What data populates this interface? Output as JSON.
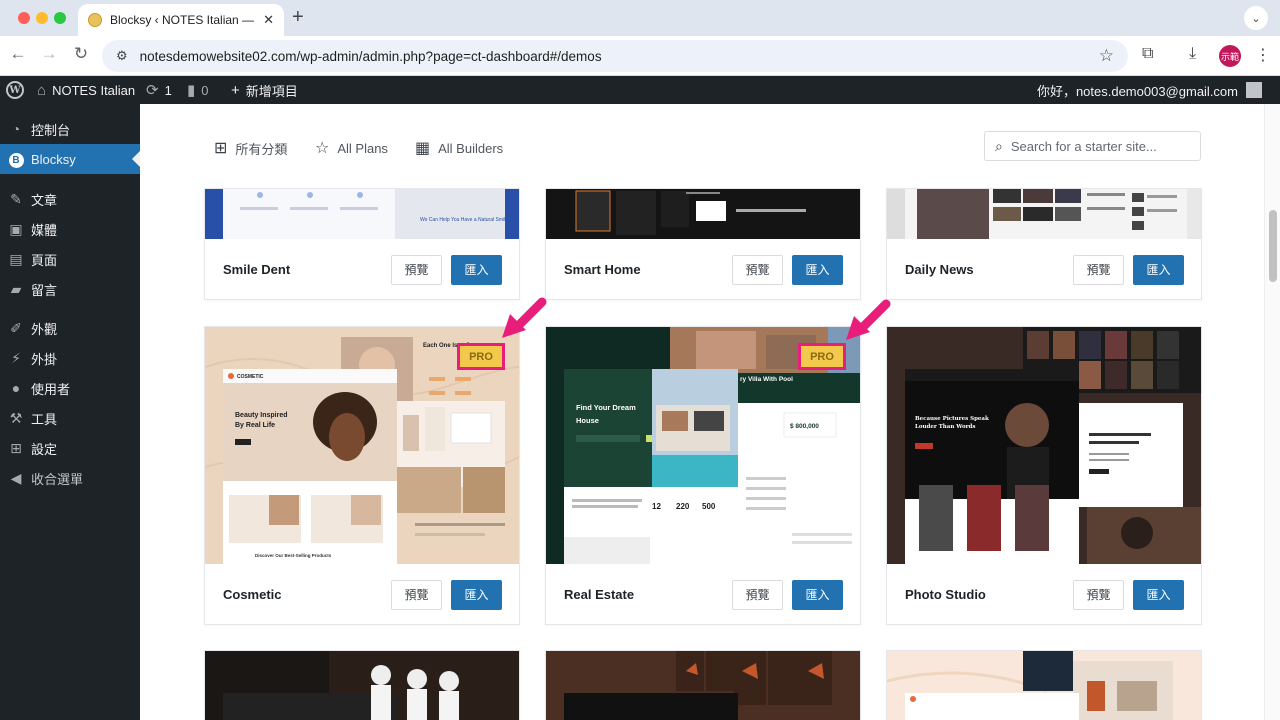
{
  "browser": {
    "tab_title": "Blocksy ‹ NOTES Italian — W",
    "tab_close": "✕",
    "new_tab": "+",
    "url": "notesdemowebsite02.com/wp-admin/admin.php?page=ct-dashboard#/demos",
    "profile_label": "示範"
  },
  "adminbar": {
    "site_name": "NOTES Italian",
    "updates_count": "1",
    "comments_count": "0",
    "new_item": "新增項目",
    "greeting": "你好，notes.demo003@gmail.com"
  },
  "sidebar": {
    "items": [
      {
        "label": "控制台",
        "icon": "dashboard-icon"
      },
      {
        "label": "Blocksy",
        "icon": "blocksy-icon"
      },
      {
        "label": "文章",
        "icon": "pin-icon"
      },
      {
        "label": "媒體",
        "icon": "media-icon"
      },
      {
        "label": "頁面",
        "icon": "page-icon"
      },
      {
        "label": "留言",
        "icon": "comment-icon"
      },
      {
        "label": "外觀",
        "icon": "brush-icon"
      },
      {
        "label": "外掛",
        "icon": "plugin-icon"
      },
      {
        "label": "使用者",
        "icon": "user-icon"
      },
      {
        "label": "工具",
        "icon": "wrench-icon"
      },
      {
        "label": "設定",
        "icon": "settings-icon"
      },
      {
        "label": "收合選單",
        "icon": "collapse-icon"
      }
    ]
  },
  "filters": {
    "categories": "所有分類",
    "plans": "All Plans",
    "builders": "All Builders",
    "search_placeholder": "Search for a starter site..."
  },
  "cards": [
    {
      "name": "Smile Dent",
      "preview": "預覽",
      "import": "匯入"
    },
    {
      "name": "Smart Home",
      "preview": "預覽",
      "import": "匯入"
    },
    {
      "name": "Daily News",
      "preview": "預覽",
      "import": "匯入"
    },
    {
      "name": "Cosmetic",
      "preview": "預覽",
      "import": "匯入",
      "badge": "PRO"
    },
    {
      "name": "Real Estate",
      "preview": "預覽",
      "import": "匯入",
      "badge": "PRO"
    },
    {
      "name": "Photo Studio",
      "preview": "預覽",
      "import": "匯入"
    }
  ],
  "thumb_text": {
    "cosmetic_brand": "COSMETIC",
    "cosmetic_headline": "Beauty Inspired By Real Life",
    "cosmetic_side": "Each One Is ... One",
    "realestate_headline": "Find Your Dream House",
    "realestate_price": "$ 800,000",
    "realestate_villa": "ry Villa With Pool",
    "realestate_stats": [
      "12",
      "220",
      "500"
    ],
    "photo_headline": "Because Pictures Speak Louder Than Words",
    "smartdent_text": "We Can Help You Have a Natural Smile"
  },
  "colors": {
    "wp_blue": "#2271b1",
    "admin_dark": "#1d2327",
    "pro_yellow": "#f2c94c",
    "highlight_pink": "#e91e7a"
  }
}
